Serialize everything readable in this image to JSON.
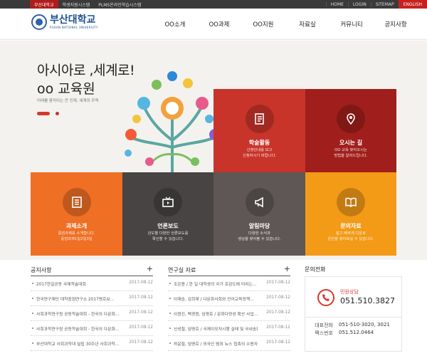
{
  "topbar": {
    "univ": "부산대학교",
    "links_left": [
      "학생지원시스템",
      "PLMS온라인학습시스템"
    ],
    "links_right": [
      "HOME",
      "LOGIN",
      "SITEMAP"
    ],
    "english": "ENGLISH"
  },
  "logo": {
    "ko": "부산대학교",
    "en": "PUSAN NATIONAL UNIVERSITY"
  },
  "nav": [
    "OO소개",
    "OO과제",
    "OO지원",
    "자료실",
    "커뮤니티",
    "공지사항"
  ],
  "hero": {
    "title1": "아시아로 ,세계로!",
    "title2": "oo 교육원",
    "subtitle": "미래를 움직이는 큰 인재, 세계의 주역"
  },
  "tiles": [
    {
      "title": "학술활동",
      "desc": [
        "신청안내를 보고",
        "신청하시기 바랍니다."
      ],
      "color": "#c8342a",
      "icon": "document-icon"
    },
    {
      "title": "오시는 길",
      "desc": [
        "OO 교육 찾아오시는",
        "방법을 알려드립니다."
      ],
      "color": "#a01e1b",
      "icon": "location-pin-icon"
    },
    {
      "title": "과제소개",
      "desc": [
        "중점과제를 소개합니다.",
        "중점과제1일2일3일"
      ],
      "color": "#ef6f24",
      "icon": "document-list-icon"
    },
    {
      "title": "언론보도",
      "desc": [
        "년도별 다양한 언론보도를",
        "확인할 수 있습니다."
      ],
      "color": "#474443",
      "icon": "tv-icon"
    },
    {
      "title": "알림마당",
      "desc": [
        "다양한 소식과",
        "영상을 찾아볼 수 있습니다."
      ],
      "color": "#5e5755",
      "icon": "megaphone-icon"
    },
    {
      "title": "문의자료",
      "desc": [
        "쉽고 빠르게 다운로",
        "문헌을 찾아보실 수 있습니다."
      ],
      "color": "#f39a17",
      "icon": "book-icon"
    }
  ],
  "notice": {
    "title": "공지사항",
    "rows": [
      {
        "text": "2017한일공동 국제학술대회",
        "date": "2017-08-12"
      },
      {
        "text": "한국연구재단 대학중점연구소 2017명호보...",
        "date": "2017-08-12"
      },
      {
        "text": "사회과학연구원 공동학술대회 - 한국의 다문화...",
        "date": "2017-08-12"
      },
      {
        "text": "사회과학연구원 공동학술대회 - 한국의 다문화...",
        "date": "2017-08-12"
      },
      {
        "text": "부산대학교 사회과학대 설립 30주년 사회과학...",
        "date": "2017-08-12"
      }
    ]
  },
  "research": {
    "title": "연구실 자료",
    "rows": [
      {
        "text": "조은용 / 한 일 대학생의 국가 호감도에 미치는...",
        "date": "2017-08-12"
      },
      {
        "text": "이재승, 김희재 / 다문화사회와 언어교육정책...",
        "date": "2017-08-12"
      },
      {
        "text": "이원진, 백경원, 임명호 / 문화다양성 확산 사업...",
        "date": "2017-08-12"
      },
      {
        "text": "신성철, 임명호 / 국제이모저시행 실태 및 국내송환...",
        "date": "2017-08-12"
      },
      {
        "text": "허윤철, 임명호 / 외국인 범죄 뉴스 접촉의 수용자...",
        "date": "2017-08-12"
      }
    ]
  },
  "contact": {
    "title": "문의전화",
    "label": "민원상담",
    "number": "051.510.3827",
    "items": [
      {
        "k": "대표전화",
        "v": "051-510-3020, 3021"
      },
      {
        "k": "팩스번호",
        "v": "051.512.0464"
      }
    ]
  }
}
